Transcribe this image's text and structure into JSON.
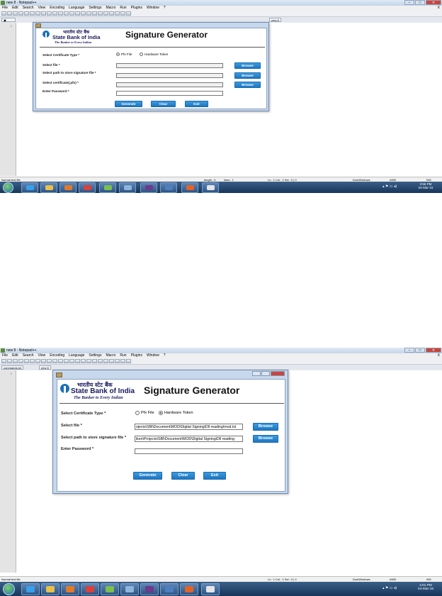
{
  "screen1": {
    "window_title": "new 8 - Notepad++",
    "menu": [
      "File",
      "Edit",
      "Search",
      "View",
      "Encoding",
      "Language",
      "Settings",
      "Macro",
      "Run",
      "Plugins",
      "Window",
      "?"
    ],
    "menu_close": "X",
    "tabs": [
      "new 8"
    ],
    "line_number": "1",
    "status": {
      "type": "Normal text file",
      "length": "length : 0",
      "lines": "lines : 1",
      "position": "Ln : 1    Col : 1    Sel : 0 | 0",
      "eol": "Dos\\Windows",
      "encoding": "ANSI",
      "mode": "INS"
    },
    "clock": {
      "time": "3:55 PM",
      "date": "04-Mar-15"
    },
    "dialog": {
      "hindi_name": "भारतीय स्टेट बैंक",
      "bank_name": "State Bank of India",
      "tagline": "The Banker to Every Indian",
      "heading": "Signature Generator",
      "certificate_type_label": "Select Certificate Type *",
      "radio_pfx": "Pfx File",
      "radio_token": "Hardware Token",
      "selected": "pfx",
      "select_file_label": "Select file *",
      "signature_path_label": "Select path to store signature file *",
      "certificate_label": "Select certificate(.pfx) *",
      "password_label": "Enter Password *",
      "select_file_value": "",
      "signature_path_value": "",
      "certificate_value": "",
      "password_value": "",
      "browse": "Browse",
      "generate": "Generate",
      "clear": "Clear",
      "exit": "Exit"
    }
  },
  "screen2": {
    "window_title": "new 8 - Notepad++",
    "menu": [
      "File",
      "Edit",
      "Search",
      "View",
      "Encoding",
      "Language",
      "Settings",
      "Macro",
      "Run",
      "Plugins",
      "Window",
      "?"
    ],
    "menu_close": "X",
    "tabs": [
      "commands.txt",
      "new 8"
    ],
    "line_number": "1",
    "status": {
      "type": "Normal text file",
      "position": "Ln : 1    Col : 1    Sel : 0 | 0",
      "eol": "Dos\\Windows",
      "encoding": "ANSI",
      "mode": "INS"
    },
    "clock": {
      "time": "4:01 PM",
      "date": "04-Mar-15"
    },
    "dialog": {
      "hindi_name": "भारतीय स्टेट बैंक",
      "bank_name": "State Bank of India",
      "tagline": "The Banker to Every Indian",
      "heading": "Signature Generator",
      "certificate_type_label": "Select Certificate Type *",
      "radio_pfx": "Pfx File",
      "radio_token": "Hardware Token",
      "selected": "token",
      "select_file_label": "Select file *",
      "signature_path_label": "Select path to store signature file *",
      "password_label": "Enter Password *",
      "select_file_value": "ojects\\SBI\\Document\\MOD\\Digital Signing\\Dll reading\\mod.txt",
      "signature_path_value": "iken\\Projects\\SBI\\Document\\MOD\\Digital Signing\\Dll reading",
      "password_value": "",
      "browse": "Browse",
      "generate": "Generate",
      "clear": "Clear",
      "exit": "Exit"
    }
  },
  "colors": {
    "button": "#1f76bf",
    "taskbar": "#17355a",
    "dialog_frame": "#c7d8ec"
  }
}
